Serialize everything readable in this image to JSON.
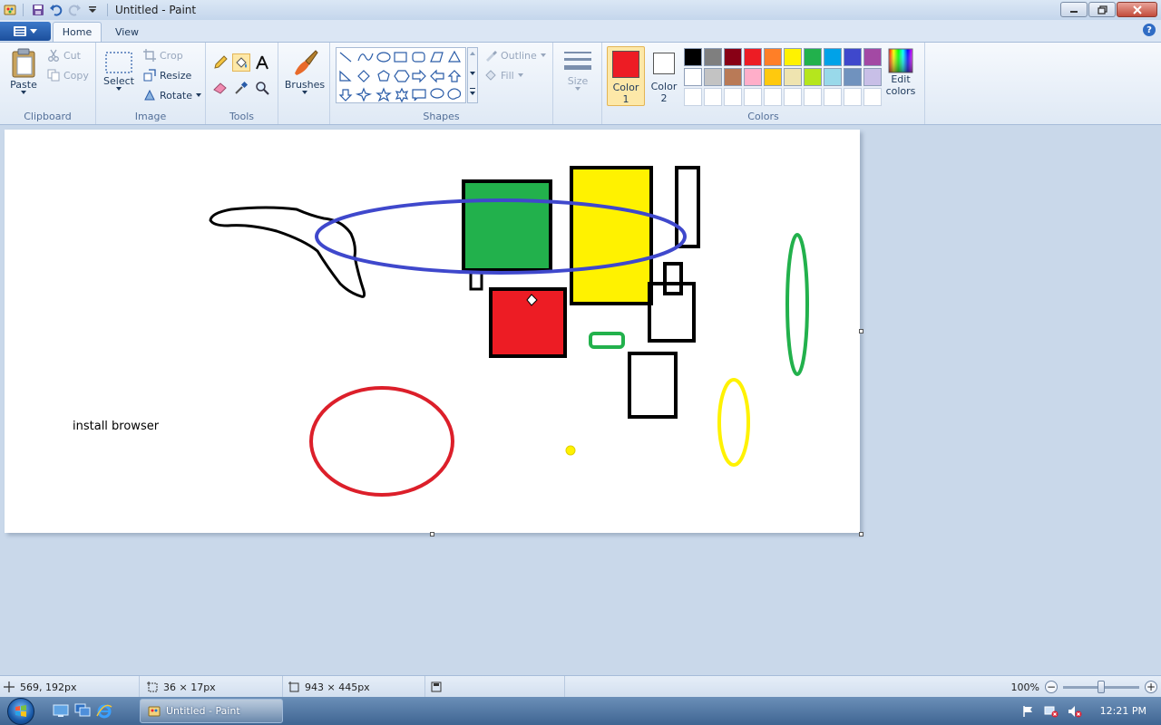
{
  "window": {
    "title": "Untitled - Paint"
  },
  "tabs": {
    "home": "Home",
    "view": "View"
  },
  "ribbon": {
    "clipboard": {
      "label": "Clipboard",
      "paste": "Paste",
      "cut": "Cut",
      "copy": "Copy"
    },
    "image": {
      "label": "Image",
      "select": "Select",
      "crop": "Crop",
      "resize": "Resize",
      "rotate": "Rotate"
    },
    "tools": {
      "label": "Tools"
    },
    "brushes": {
      "label": "Brushes"
    },
    "shapes": {
      "label": "Shapes",
      "outline": "Outline",
      "fill": "Fill"
    },
    "size": {
      "label": "Size"
    },
    "colors": {
      "label": "Colors",
      "color1": "Color",
      "color1_num": "1",
      "color2": "Color",
      "color2_num": "2",
      "edit_colors_1": "Edit",
      "edit_colors_2": "colors",
      "color1_value": "#ed1c24",
      "color2_value": "#ffffff",
      "palette_row1": [
        "#000000",
        "#7f7f7f",
        "#880015",
        "#ed1c24",
        "#ff7f27",
        "#fff200",
        "#22b14c",
        "#00a2e8",
        "#3f48cc",
        "#a349a4"
      ],
      "palette_row2": [
        "#ffffff",
        "#c3c3c3",
        "#b97a57",
        "#ffaec9",
        "#ffc90e",
        "#efe4b0",
        "#b5e61d",
        "#99d9ea",
        "#7092be",
        "#c8bfe7"
      ],
      "palette_row3": [
        "#ffffff",
        "#ffffff",
        "#ffffff",
        "#ffffff",
        "#ffffff",
        "#ffffff",
        "#ffffff",
        "#ffffff",
        "#ffffff",
        "#ffffff"
      ]
    }
  },
  "canvas": {
    "text": "install browser"
  },
  "status": {
    "cursor_pos": "569, 192px",
    "selection_size": "36 × 17px",
    "canvas_size": "943 × 445px",
    "zoom": "100%",
    "zoom_level": 0.5
  },
  "taskbar": {
    "active_task": "Untitled - Paint",
    "clock": "12:21 PM"
  }
}
